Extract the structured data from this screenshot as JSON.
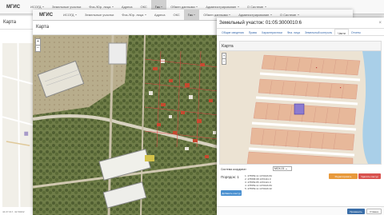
{
  "nav": {
    "brand": "МГИС",
    "items": [
      {
        "label": "ИСОГД",
        "caret": true
      },
      {
        "label": "Земельные участки",
        "caret": false
      },
      {
        "label": "Физ./Юр. лица",
        "caret": true
      },
      {
        "label": "Адреса",
        "caret": false
      },
      {
        "label": "ОКС",
        "caret": false
      },
      {
        "label": "Газ",
        "caret": true
      },
      {
        "label": "Обмен данными",
        "caret": true
      },
      {
        "label": "Администрирование",
        "caret": true
      },
      {
        "label": "О Системе",
        "caret": true
      }
    ],
    "active_item": "Газ"
  },
  "panel1": {
    "title": "Карта",
    "coord": "44.07.017, 42.59402"
  },
  "map2": {
    "title": "Карта",
    "zoom_in": "+",
    "zoom_out": "−"
  },
  "dialog": {
    "title": "Земельный участок: 01:05:3000010:6",
    "close": "×",
    "tabs": [
      "Общие сведения",
      "Права",
      "Характеристики",
      "Физ. лица",
      "Земельный контроль",
      "Части",
      "Отчеты"
    ],
    "active_tab": "Части",
    "map_title": "Карта",
    "coord_system_label": "Система координат",
    "coord_system_value": "МСК-01",
    "contour_label": "Порядок: 1",
    "coords": [
      "1: 475559.11 1370426.84",
      "2: 475558.98 1370441.0",
      "3: 475559.85 1370421.0",
      "4: 475559.11 1370426.84",
      "5: 475559.11 1370426.32"
    ],
    "btn_orange": "Редактировать",
    "btn_red": "Удалить контур",
    "btn_blue": "Добавить контур",
    "btn_apply": "Применить",
    "btn_cancel": "Отмена"
  }
}
